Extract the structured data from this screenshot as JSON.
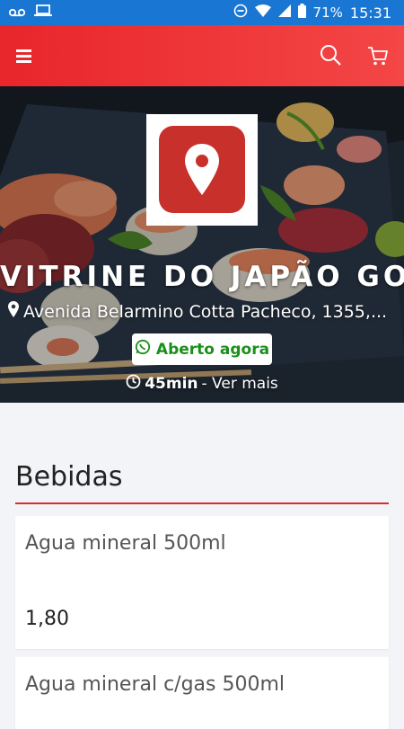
{
  "status_bar": {
    "battery": "71%",
    "time": "15:31"
  },
  "header": {
    "icons": [
      "menu-icon",
      "search-icon",
      "cart-icon"
    ],
    "accent_color": "#e8262b"
  },
  "store": {
    "name": "VITRINE DO JAPÃO GO...",
    "address": "Avenida Belarmino Cotta Pacheco, 1355,...",
    "status": "Aberto agora",
    "delivery_time": "45min",
    "delivery_more": " - Ver mais"
  },
  "menu": {
    "section_title": "Bebidas",
    "items": [
      {
        "name": "Agua mineral 500ml",
        "price": "1,80"
      },
      {
        "name": "Agua mineral c/gas 500ml",
        "price": ""
      }
    ]
  }
}
